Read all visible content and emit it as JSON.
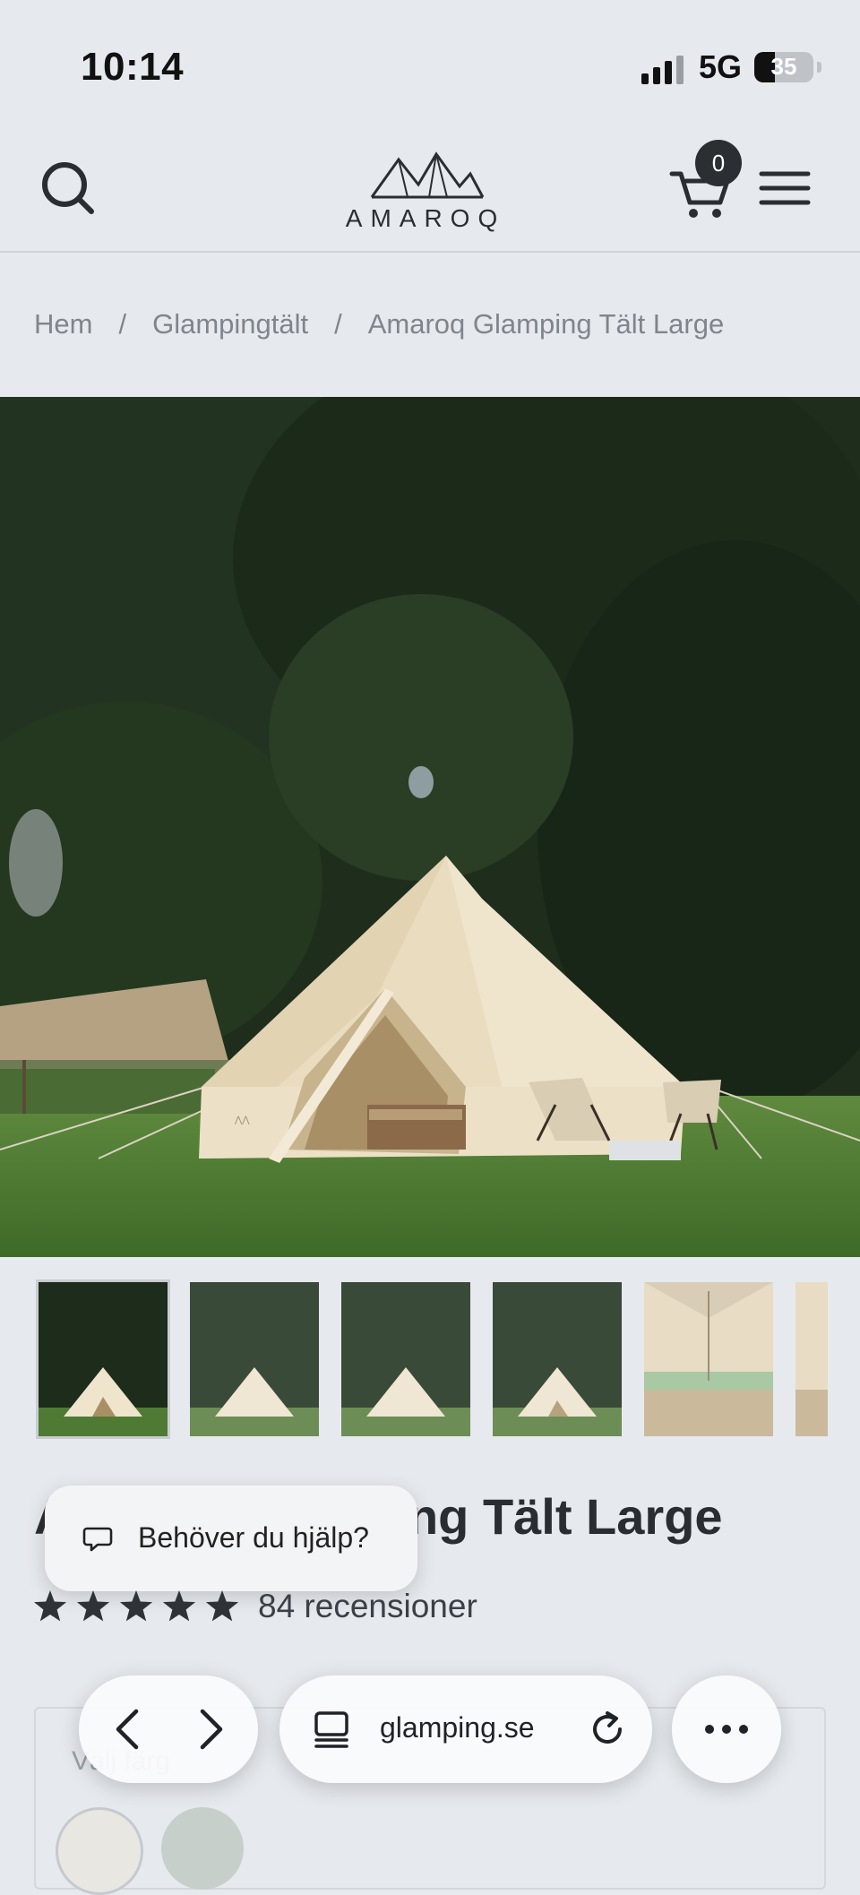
{
  "status_bar": {
    "time": "10:14",
    "network": "5G",
    "battery_level": "35",
    "battery_fraction": 0.35
  },
  "header": {
    "logo_text": "AMAROQ",
    "cart_count": "0",
    "icons": [
      "search-icon",
      "mountain-logo",
      "cart-icon",
      "hamburger-menu-icon"
    ]
  },
  "breadcrumb": {
    "items": [
      "Hem",
      "Glampingtält",
      "Amaroq Glamping Tält Large"
    ],
    "separator": "/"
  },
  "product": {
    "title": "Amaroq Glamping Tält Large",
    "rating": 5,
    "review_count": "84 recensioner",
    "thumbnail_count": 6
  },
  "help_widget": {
    "label": "Behöver du hjälp?",
    "icon": "chat-bubble-icon"
  },
  "variant": {
    "label": "Välj färg",
    "swatch_colors": [
      "#e8e7e2",
      "#c7cfcb"
    ]
  },
  "browser": {
    "url": "glamping.se",
    "icons": [
      "chevron-left-icon",
      "chevron-right-icon",
      "tabs-icon",
      "reload-icon",
      "more-icon"
    ]
  },
  "colors": {
    "page_bg": "#e6e9ee",
    "text": "#2a2e33",
    "muted": "#80858c",
    "badge": "#2b2f33",
    "tent": "#efe4cc",
    "grass": "#4f7a34",
    "trees": "#1d2c1b"
  }
}
